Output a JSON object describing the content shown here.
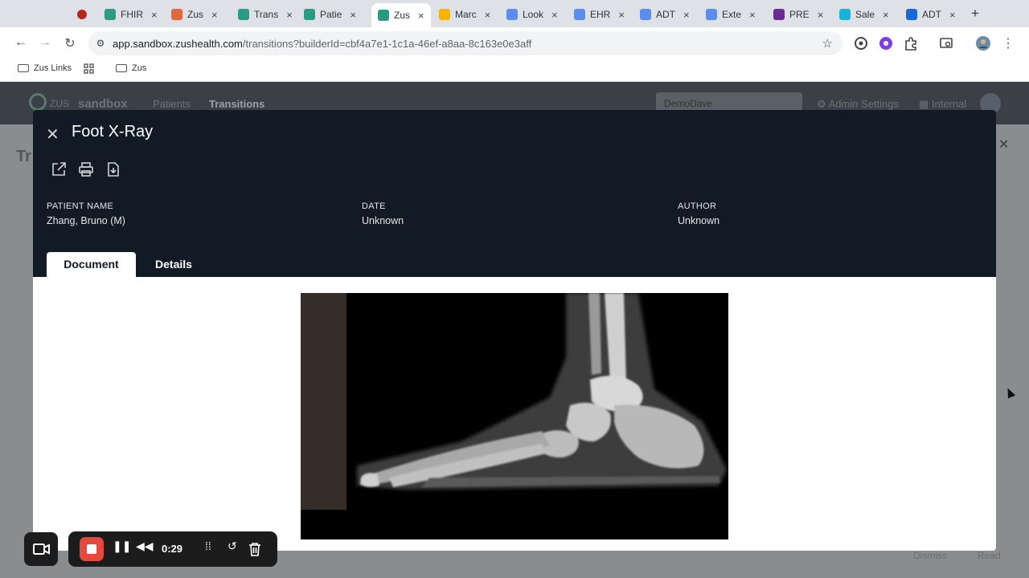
{
  "browser": {
    "tabs": [
      {
        "label": "",
        "color": "#b3261e"
      },
      {
        "label": "FHIR",
        "color": "#2b9a83"
      },
      {
        "label": "Zus",
        "color": "#e0673a"
      },
      {
        "label": "Trans",
        "color": "#2b9a83"
      },
      {
        "label": "Patie",
        "color": "#2b9a83"
      },
      {
        "label": "Zus",
        "color": "#2b9a83"
      },
      {
        "label": "Marc",
        "color": "#f4b400"
      },
      {
        "label": "Look",
        "color": "#5b8def"
      },
      {
        "label": "EHR",
        "color": "#5b8def"
      },
      {
        "label": "ADT",
        "color": "#5b8def"
      },
      {
        "label": "Exte",
        "color": "#5b8def"
      },
      {
        "label": "PRE",
        "color": "#6a2c91"
      },
      {
        "label": "Sale",
        "color": "#19b3d8"
      },
      {
        "label": "ADT",
        "color": "#1868db"
      }
    ],
    "close_glyph": "×",
    "new_tab_glyph": "+",
    "url_host": "app.sandbox.zushealth.com",
    "url_path": "/transitions?builderId=cbf4a7e1-1c1a-46ef-a8aa-8c163e0e3aff",
    "bookmarks": [
      {
        "label": "Zus Links"
      },
      {
        "label": ""
      },
      {
        "label": "Zus"
      }
    ]
  },
  "app": {
    "brand_zus": "ZUS",
    "brand_env": "sandbox",
    "nav": [
      "Patients",
      "Transitions"
    ],
    "user_select": "DemoDave",
    "admin_settings": "Admin Settings",
    "internal": "Internal",
    "bg_title": "Tr",
    "bg_buttons": {
      "dismiss": "Dismiss",
      "read": "Read"
    }
  },
  "modal": {
    "title": "Foot X-Ray",
    "close_glyph": "✕",
    "fields": [
      {
        "label": "PATIENT NAME",
        "value": "Zhang, Bruno (M)"
      },
      {
        "label": "DATE",
        "value": "Unknown"
      },
      {
        "label": "AUTHOR",
        "value": "Unknown"
      }
    ],
    "tabs": {
      "document": "Document",
      "details": "Details"
    }
  },
  "recorder": {
    "time": "0:29"
  },
  "colors": {
    "modal_header": "#121a25",
    "accent": "#2b9a83",
    "record": "#e5483d"
  }
}
